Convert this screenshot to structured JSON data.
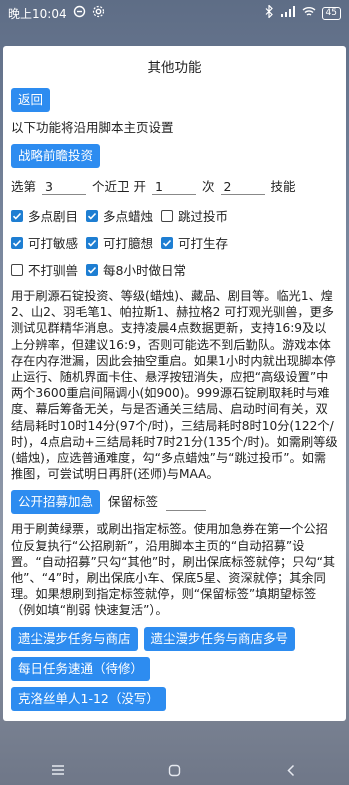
{
  "status": {
    "time": "晚上10:04",
    "battery": "45"
  },
  "title": "其他功能",
  "back_label": "返回",
  "intro": "以下功能将沿用脚本主页设置",
  "strategy_button": "战略前瞻投资",
  "selector": {
    "l1": "选第",
    "v1": "3",
    "l2": "个近卫 开",
    "v2": "1",
    "l3": "次",
    "v3": "2",
    "l4": "技能"
  },
  "checkboxes": [
    {
      "label": "多点剧目",
      "checked": true
    },
    {
      "label": "多点蜡烛",
      "checked": true
    },
    {
      "label": "跳过投币",
      "checked": false
    },
    {
      "label": "可打敏感",
      "checked": true
    },
    {
      "label": "可打臆想",
      "checked": true
    },
    {
      "label": "可打生存",
      "checked": true
    },
    {
      "label": "不打驯兽",
      "checked": false
    },
    {
      "label": "每8小时做日常",
      "checked": true
    }
  ],
  "desc1": "用于刷源石锭投资、等级(蜡烛)、藏品、剧目等。临光1、煌2、山2、羽毛笔1、帕拉斯1、赫拉格2 可打观光驯兽，更多测试见群精华消息。支持凌晨4点数据更新，支持16:9及以上分辨率，但建议16:9，否则可能选不到后勤队。游戏本体存在内存泄漏，因此会抽空重启。如果1小时内就出现脚本停止运行、随机界面卡住、悬浮按钮消失，应把“高级设置”中两个3600重启间隔调小(如900)。999源石锭刷取耗时与难度、幕后筹备无关，与是否通关三结局、启动时间有关，双结局耗时10时14分(97个/时)，三结局耗时8时10分(122个/时)，4点启动+三结局耗时7时21分(135个/时)。如需刷等级(蜡烛)，应选普通难度，勾“多点蜡烛”与“跳过投币”。如需推图，可尝试明日再肝(还师)与MAA。",
  "recruit_button": "公开招募加急",
  "keep_label": "保留标签",
  "keep_value": "",
  "desc2": "用于刷黄绿票，或刷出指定标签。使用加急券在第一个公招位反复执行“公招刷新”，沿用脚本主页的“自动招募”设置。“自动招募”只勾“其他”时，刷出保底标签就停；只勾“其他”、“4”时，刷出保底小车、保底5星、资深就停；其余同理。如果想刷到指定标签就停，则“保留标签”填期望标签（例如填“削弱 快速复活”）。",
  "task_buttons": [
    "遗尘漫步任务与商店",
    "遗尘漫步任务与商店多号",
    "每日任务速通（待修）",
    "克洛丝单人1-12（没写）"
  ]
}
